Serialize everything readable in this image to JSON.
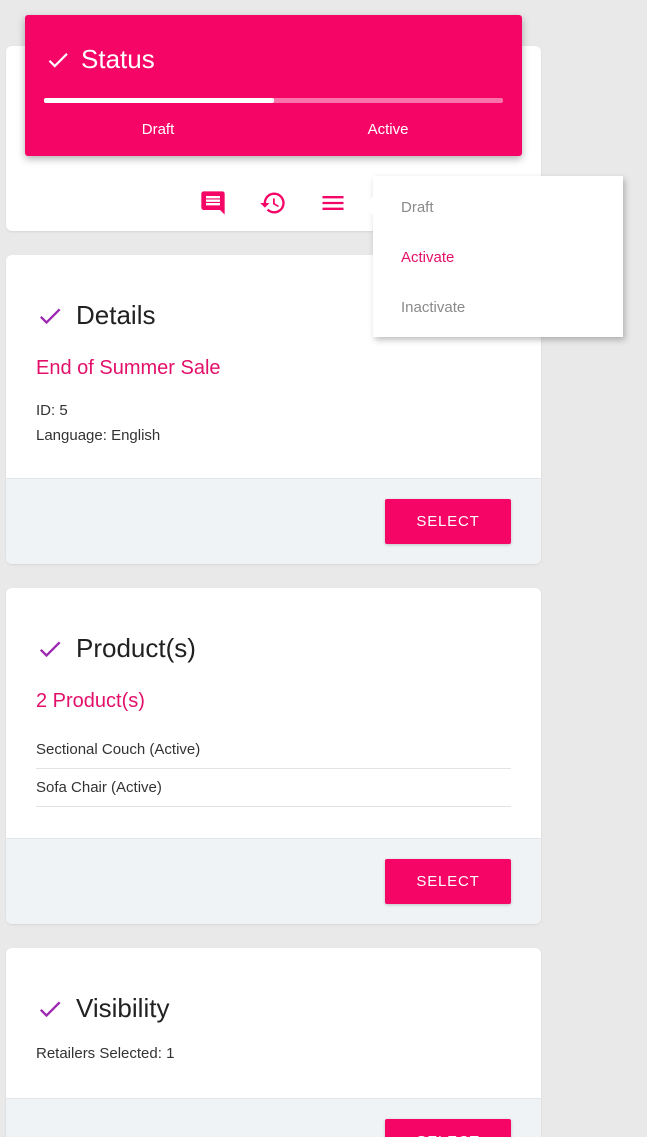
{
  "status": {
    "title": "Status",
    "steps": [
      "Draft",
      "Active"
    ],
    "progress_percent": 50
  },
  "toolbar": {
    "icons": [
      "comment-icon",
      "history-icon",
      "menu-icon"
    ]
  },
  "dropdown": {
    "items": [
      {
        "label": "Draft",
        "active": false
      },
      {
        "label": "Activate",
        "active": true
      },
      {
        "label": "Inactivate",
        "active": false
      }
    ]
  },
  "details": {
    "title": "Details",
    "name": "End of Summer Sale",
    "id_line": "ID: 5",
    "language_line": "Language: English",
    "select_label": "SELECT"
  },
  "products": {
    "title": "Product(s)",
    "count_label": "2 Product(s)",
    "items": [
      "Sectional Couch (Active)",
      "Sofa Chair (Active)"
    ],
    "select_label": "SELECT"
  },
  "visibility": {
    "title": "Visibility",
    "retailers_line": "Retailers Selected: 1",
    "select_label": "SELECT"
  },
  "colors": {
    "accent": "#f50566",
    "check": "#9c27b0",
    "link": "#e3106a",
    "footer_bg": "#f0f3f6"
  }
}
